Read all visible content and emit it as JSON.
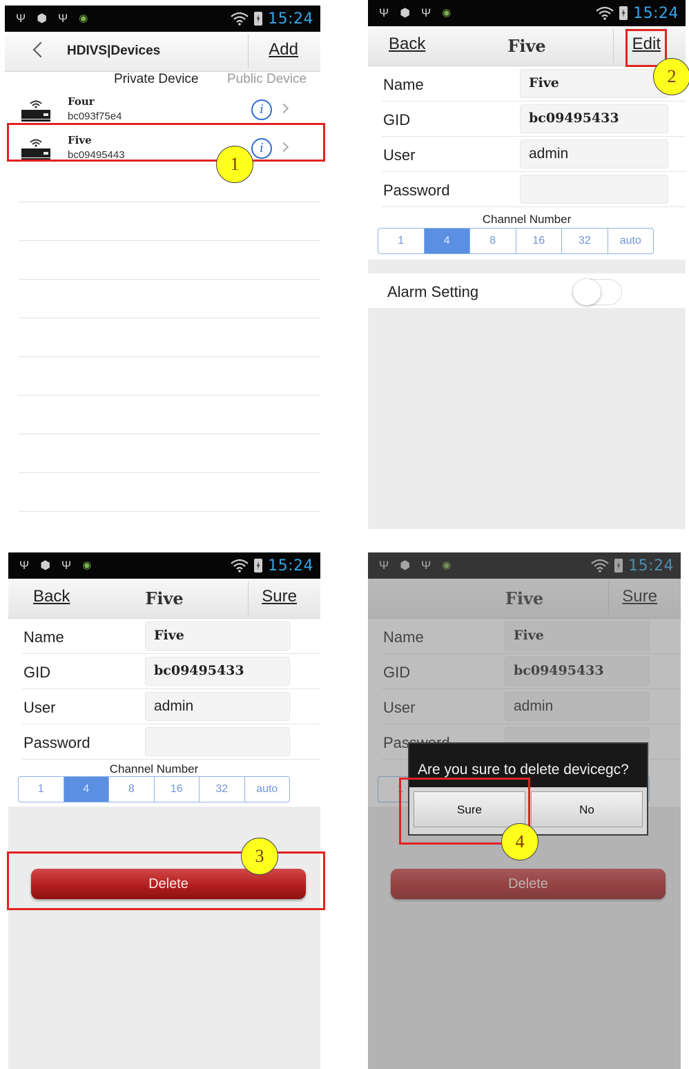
{
  "status_bar": {
    "time": "15:24"
  },
  "screen1": {
    "title": "HDIVS|Devices",
    "add_label": "Add",
    "tabs": {
      "private": "Private Device",
      "public": "Public Device"
    },
    "devices": [
      {
        "name": "Four",
        "gid": "bc093f75e4"
      },
      {
        "name": "Five",
        "gid": "bc09495443"
      }
    ]
  },
  "screen2": {
    "back_label": "Back",
    "title": "Five",
    "edit_label": "Edit",
    "alarm_label": "Alarm Setting",
    "alarm_on": false
  },
  "screen3": {
    "back_label": "Back",
    "title": "Five",
    "sure_label": "Sure",
    "delete_label": "Delete"
  },
  "screen4": {
    "title": "Five",
    "sure_label": "Sure",
    "delete_label": "Delete",
    "dialog": {
      "message": "Are you sure to delete devicegc?",
      "confirm": "Sure",
      "cancel": "No"
    }
  },
  "form": {
    "labels": {
      "name": "Name",
      "gid": "GID",
      "user": "User",
      "password": "Password"
    },
    "values": {
      "name": "Five",
      "gid": "bc09495433",
      "user": "admin",
      "password": ""
    },
    "channel_label": "Channel Number",
    "channels": [
      "1",
      "4",
      "8",
      "16",
      "32",
      "auto"
    ],
    "selected_channel": "4"
  },
  "markers": [
    "1",
    "2",
    "3",
    "4"
  ],
  "colors": {
    "annotation_red": "#e32222",
    "marker_yellow": "#ffff1e",
    "clock_blue": "#35a5e6",
    "segment_blue": "#5b8fe2",
    "delete_red": "#b31e1e"
  }
}
